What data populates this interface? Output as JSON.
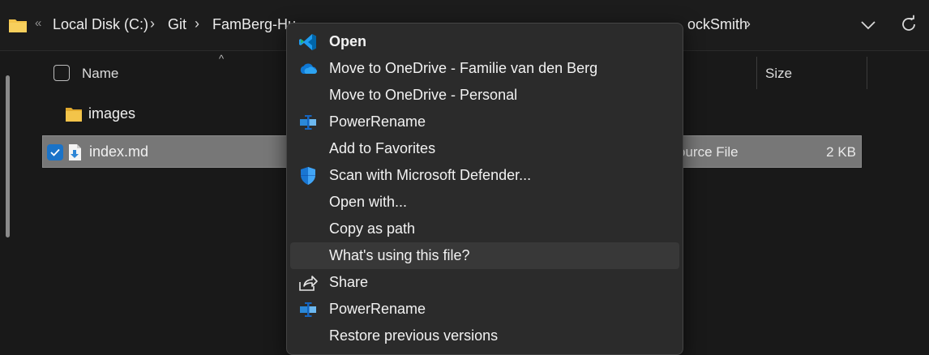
{
  "address_bar": {
    "breadcrumbs": [
      "Local Disk (C:)",
      "Git",
      "FamBerg-Hu",
      "ockSmith"
    ],
    "overflow_chevron": "«",
    "separator": "›"
  },
  "file_list": {
    "columns": {
      "name": "Name",
      "size": "Size"
    },
    "sort_indicator": "^",
    "rows": [
      {
        "name": "images",
        "kind": "folder",
        "type": "",
        "size": ""
      },
      {
        "name": "index.md",
        "kind": "file",
        "type": "ource File",
        "size": "2 KB",
        "selected": true
      }
    ]
  },
  "context_menu": {
    "items": [
      {
        "label": "Open",
        "icon": "vscode-icon",
        "bold": true
      },
      {
        "label": "Move to OneDrive - Familie van den Berg",
        "icon": "onedrive-icon"
      },
      {
        "label": "Move to OneDrive - Personal",
        "icon": ""
      },
      {
        "label": "PowerRename",
        "icon": "powerrename-icon"
      },
      {
        "label": "Add to Favorites",
        "icon": ""
      },
      {
        "label": "Scan with Microsoft Defender...",
        "icon": "defender-shield-icon"
      },
      {
        "label": "Open with...",
        "icon": ""
      },
      {
        "label": "Copy as path",
        "icon": ""
      },
      {
        "label": "What's using this file?",
        "icon": "",
        "hover": true
      },
      {
        "label": "Share",
        "icon": "share-icon"
      },
      {
        "label": "PowerRename",
        "icon": "powerrename-icon"
      },
      {
        "label": "Restore previous versions",
        "icon": ""
      }
    ]
  },
  "colors": {
    "accent": "#1a73c8",
    "selection": "#777777",
    "menu_bg": "#2b2b2b",
    "menu_hover": "#383838",
    "folder_yellow": "#f3c44a"
  }
}
